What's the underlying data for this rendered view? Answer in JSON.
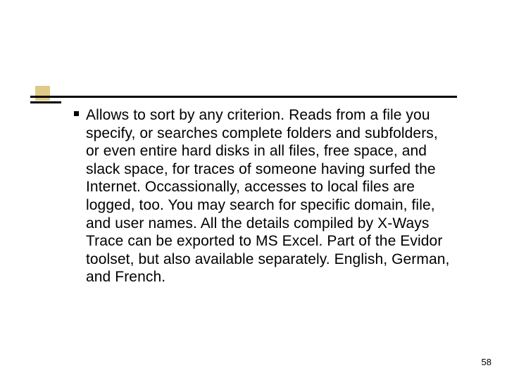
{
  "body": {
    "text": "Allows to sort by any criterion. Reads from a file you specify, or searches complete folders and subfolders, or even entire hard disks in all files, free space, and slack space, for traces of someone having surfed the Internet. Occassionally, accesses to local files are logged, too. You may search for specific domain, file, and user names. All the details compiled by X-Ways Trace can be exported to MS Excel. Part of the Evidor toolset, but also available separately. English, German, and French."
  },
  "page_number": "58"
}
